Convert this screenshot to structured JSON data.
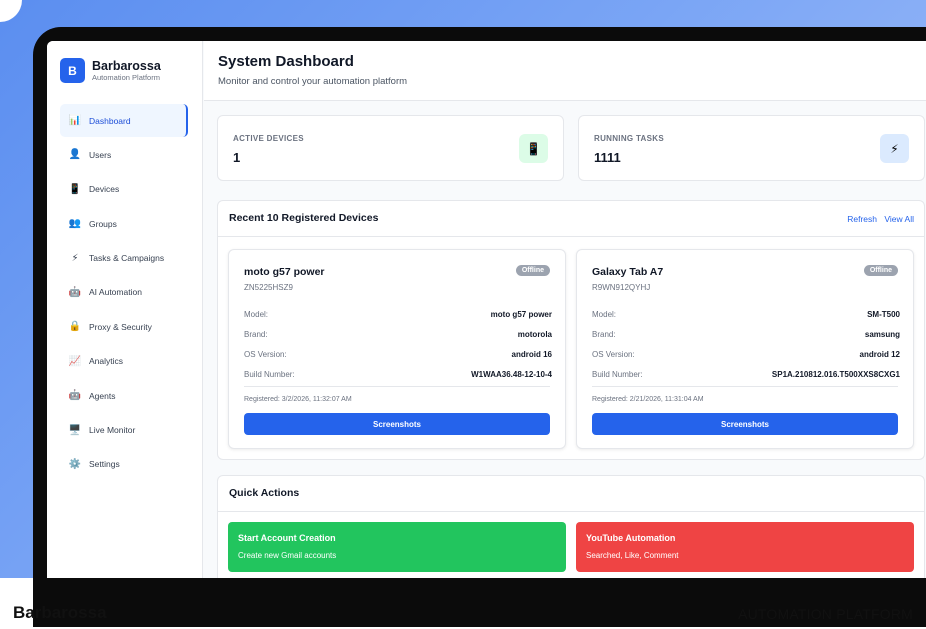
{
  "brand": {
    "logo_letter": "B",
    "name": "Barbarossa",
    "subtitle": "Automation Platform"
  },
  "sidebar": {
    "items": [
      {
        "label": "Dashboard",
        "icon": "chart-icon",
        "glyph": "📊",
        "active": true
      },
      {
        "label": "Users",
        "icon": "user-icon",
        "glyph": "👤"
      },
      {
        "label": "Devices",
        "icon": "phone-icon",
        "glyph": "📱"
      },
      {
        "label": "Groups",
        "icon": "group-icon",
        "glyph": "👥"
      },
      {
        "label": "Tasks & Campaigns",
        "icon": "lightning-icon",
        "glyph": "⚡"
      },
      {
        "label": "AI Automation",
        "icon": "robot-icon",
        "glyph": "🤖"
      },
      {
        "label": "Proxy & Security",
        "icon": "lock-icon",
        "glyph": "🔒"
      },
      {
        "label": "Analytics",
        "icon": "trend-icon",
        "glyph": "📈"
      },
      {
        "label": "Agents",
        "icon": "robot-icon",
        "glyph": "🤖"
      },
      {
        "label": "Live Monitor",
        "icon": "monitor-icon",
        "glyph": "🖥️"
      },
      {
        "label": "Settings",
        "icon": "gear-icon",
        "glyph": "⚙️"
      }
    ]
  },
  "header": {
    "title": "System Dashboard",
    "subtitle": "Monitor and control your automation platform"
  },
  "stats": {
    "active": {
      "label": "ACTIVE DEVICES",
      "value": "1",
      "icon": "phone-icon",
      "glyph": "📱",
      "icon_bg": "#dcfce7"
    },
    "tasks": {
      "label": "RUNNING TASKS",
      "value": "1111",
      "icon": "lightning-icon",
      "glyph": "⚡",
      "icon_bg": "#dbeafe"
    }
  },
  "devices_panel": {
    "title": "Recent 10 Registered Devices",
    "refresh": "Refresh",
    "view_all": "View All",
    "devices": [
      {
        "name": "moto g57 power",
        "serial": "ZN5225HSZ9",
        "status": "Offline",
        "rows": [
          {
            "k": "Model:",
            "v": "moto g57 power"
          },
          {
            "k": "Brand:",
            "v": "motorola"
          },
          {
            "k": "OS Version:",
            "v": "android 16"
          },
          {
            "k": "Build Number:",
            "v": "W1WAA36.48-12-10-4"
          }
        ],
        "registered": "Registered: 3/2/2026, 11:32:07 AM",
        "button": "Screenshots"
      },
      {
        "name": "Galaxy Tab A7",
        "serial": "R9WN912QYHJ",
        "status": "Offline",
        "rows": [
          {
            "k": "Model:",
            "v": "SM-T500"
          },
          {
            "k": "Brand:",
            "v": "samsung"
          },
          {
            "k": "OS Version:",
            "v": "android 12"
          },
          {
            "k": "Build Number:",
            "v": "SP1A.210812.016.T500XXS8CXG1"
          }
        ],
        "registered": "Registered: 2/21/2026, 11:31:04 AM",
        "button": "Screenshots"
      }
    ]
  },
  "quick_actions": {
    "title": "Quick Actions",
    "items": [
      {
        "title": "Start Account Creation",
        "subtitle": "Create new Gmail accounts",
        "color": "#22c55e"
      },
      {
        "title": "YouTube Automation",
        "subtitle": "Searched, Like, Comment",
        "color": "#ef4444"
      }
    ]
  },
  "footer": {
    "left": "Barbarossa",
    "right": "AUTOMATION PLATFORM"
  }
}
